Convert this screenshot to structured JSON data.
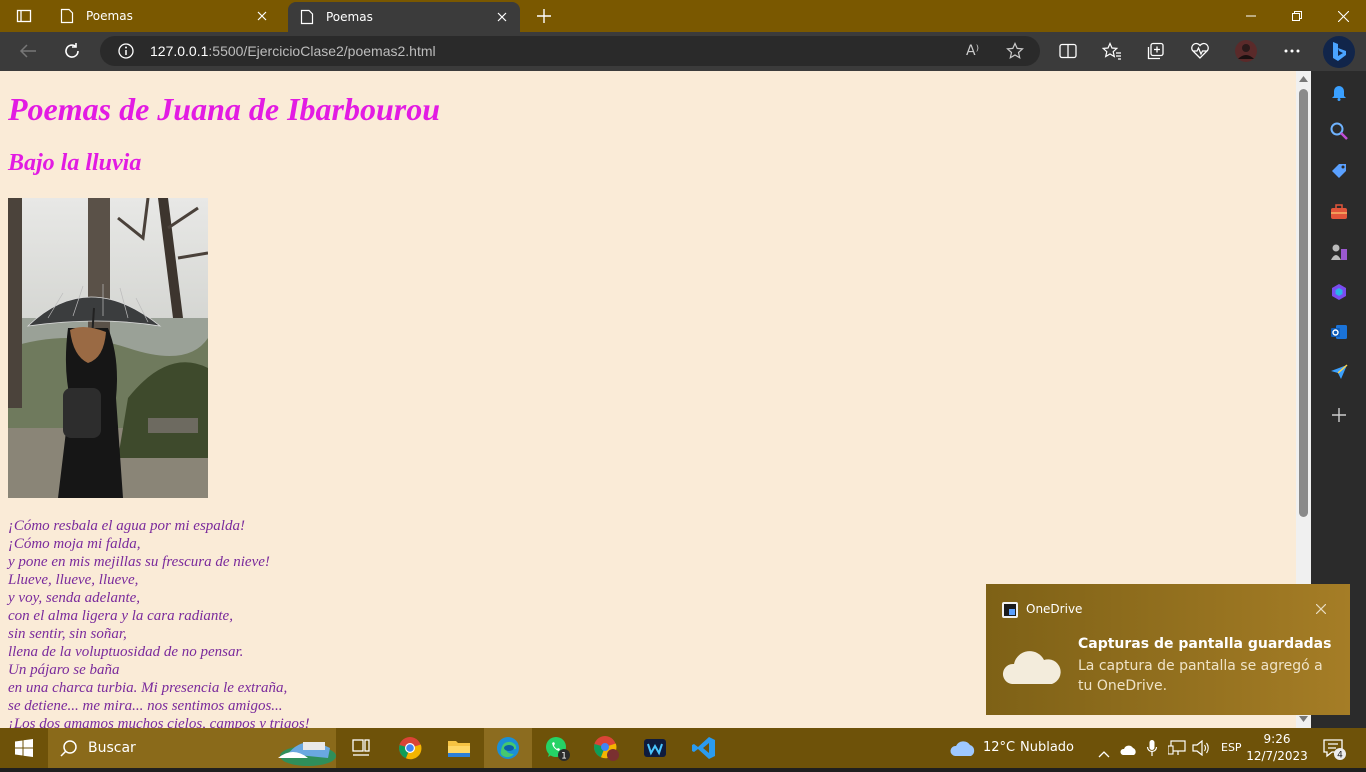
{
  "browser": {
    "tabs": [
      {
        "title": "Poemas",
        "active": false
      },
      {
        "title": "Poemas",
        "active": true
      }
    ],
    "address": {
      "host": "127.0.0.1",
      "rest": ":5500/EjercicioClase2/poemas2.html"
    },
    "read_aloud_label": "A⁾"
  },
  "page": {
    "title": "Poemas de Juana de Ibarbourou",
    "subtitle": "Bajo la lluvia",
    "poem_lines": [
      "¡Cómo resbala el agua por mi espalda!",
      "¡Cómo moja mi falda,",
      "y pone en mis mejillas su frescura de nieve!",
      "Llueve, llueve, llueve,",
      "y voy, senda adelante,",
      "con el alma ligera y la cara radiante,",
      "sin sentir, sin soñar,",
      "llena de la voluptuosidad de no pensar.",
      "Un pájaro se baña",
      "en una charca turbia. Mi presencia le extraña,",
      "se detiene... me mira... nos sentimos amigos...",
      "¡Los dos amamos muchos cielos, campos y trigos!"
    ],
    "colors": {
      "heading": "#e21be3",
      "poem": "#7a2a9c",
      "background": "#faebd7"
    }
  },
  "toast": {
    "app_name": "OneDrive",
    "title": "Capturas de pantalla guardadas",
    "body": "La captura de pantalla se agregó a tu OneDrive."
  },
  "taskbar": {
    "search_label": "Buscar",
    "weather_temp": "12°C",
    "weather_desc": "Nublado",
    "language": "ESP",
    "time": "9:26",
    "date": "12/7/2023",
    "whatsapp_badge": "1",
    "notifications_badge": "4"
  }
}
